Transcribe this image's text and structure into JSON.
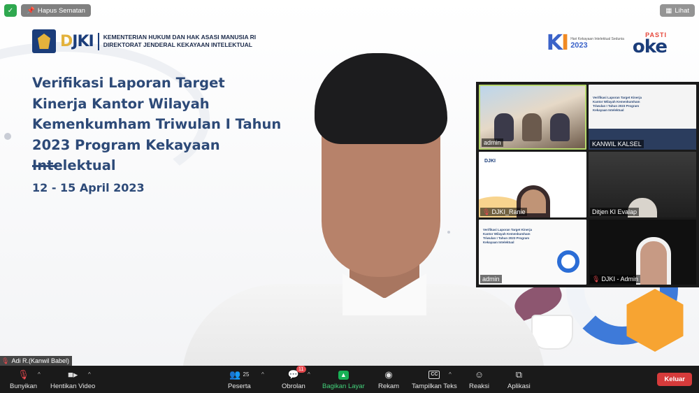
{
  "top_bar": {
    "pin_label": "Hapus Sematan",
    "view_label": "Lihat",
    "security_icon": "shield-check-icon"
  },
  "slide": {
    "ministry_line1": "KEMENTERIAN HUKUM DAN HAK ASASI MANUSIA RI",
    "ministry_line2": "DIREKTORAT JENDERAL KEKAYAAN INTELEKTUAL",
    "logo_text": "DJKI",
    "ki_mark": "KI",
    "ki_text": "Hari Kekayaan Intelektual Sedunia",
    "ki_year": "2023",
    "pasti": "PASTI",
    "oke": "OKE",
    "title": "Verifikasi Laporan Target Kinerja Kantor Wilayah Kemenkumham Triwulan I Tahun 2023 Program Kekayaan Intelektual",
    "date": "12 - 15 April 2023"
  },
  "speaker": {
    "name": "Adi R.(Kanwil Babel)"
  },
  "gallery": {
    "tiles": [
      {
        "name": "admin"
      },
      {
        "name": "KANWIL KALSEL"
      },
      {
        "name": "DJKI_Ranie"
      },
      {
        "name": "Ditjen KI Evalap"
      },
      {
        "name": "admin"
      },
      {
        "name": "DJKI - Admin"
      }
    ]
  },
  "toolbar": {
    "mute": "Bunyikan",
    "stop_video": "Hentikan Video",
    "participants": "Peserta",
    "participants_count": "25",
    "chat": "Obrolan",
    "chat_badge": "11",
    "share": "Bagikan Layar",
    "record": "Rekam",
    "captions": "Tampilkan Teks",
    "cc": "CC",
    "reactions": "Reaksi",
    "apps": "Aplikasi",
    "leave": "Keluar"
  },
  "colors": {
    "toolbar_bg": "#1a1a1a",
    "share_green": "#18b156",
    "leave_red": "#d63b3b",
    "slide_title": "#2d4a78"
  }
}
